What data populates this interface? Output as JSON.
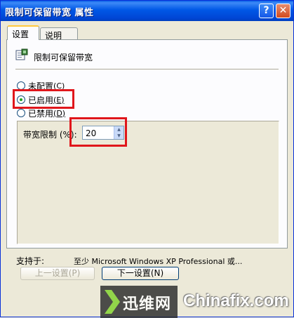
{
  "window": {
    "title": "限制可保留带宽 属性",
    "help_label": "?",
    "close_label": "✕"
  },
  "tabs": [
    {
      "label": "设置",
      "selected": true
    },
    {
      "label": "说明",
      "selected": false
    }
  ],
  "policy": {
    "name": "限制可保留带宽",
    "icon": "policy-setting-icon"
  },
  "state_options": [
    {
      "label": "未配置",
      "hotkey": "C",
      "checked": false
    },
    {
      "label": "已启用",
      "hotkey": "E",
      "checked": true
    },
    {
      "label": "已禁用",
      "hotkey": "D",
      "checked": false
    }
  ],
  "bandwidth": {
    "label": "带宽限制 (%):",
    "value": "20"
  },
  "support": {
    "label": "支持于:",
    "text": "至少 Microsoft Windows XP Professional 或..."
  },
  "buttons": {
    "prev": "上一设置(P)",
    "next": "下一设置(N)"
  },
  "watermark": {
    "cn": "迅维网",
    "en": "Chinafix.com"
  },
  "colors": {
    "title_bar": "#0058e6",
    "highlight_red": "#e0161b",
    "radio_dot": "#21a121",
    "dialog_bg": "#ece9d8"
  }
}
